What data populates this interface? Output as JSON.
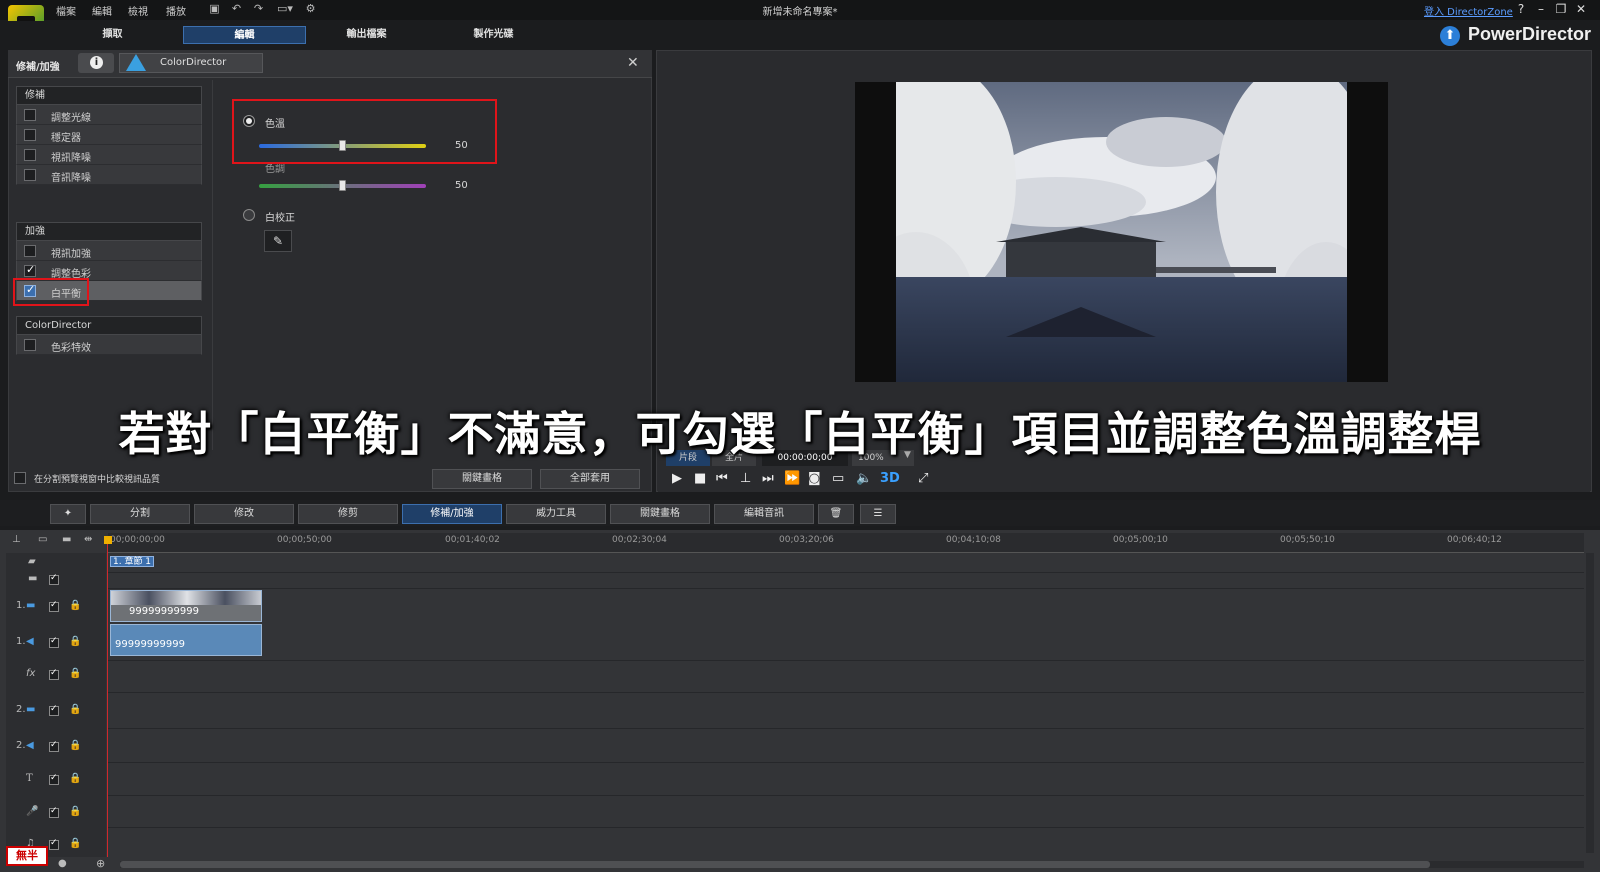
{
  "menubar": {
    "items": [
      "檔案",
      "編輯",
      "檢視",
      "播放"
    ],
    "window_title": "新增未命名專案*",
    "login_link": "登入 DirectorZone",
    "help": "?"
  },
  "main_tabs": [
    "擷取",
    "編輯",
    "輸出檔案",
    "製作光碟"
  ],
  "brand": "PowerDirector",
  "panel": {
    "title": "修補/加強",
    "colordirector_tab": "ColorDirector",
    "sections": [
      {
        "header": "修補",
        "items": [
          {
            "label": "調整光線",
            "checked": false
          },
          {
            "label": "穩定器",
            "checked": false
          },
          {
            "label": "視訊降噪",
            "checked": false
          },
          {
            "label": "音訊降噪",
            "checked": false
          }
        ]
      },
      {
        "header": "加強",
        "items": [
          {
            "label": "視訊加強",
            "checked": false
          },
          {
            "label": "調整色彩",
            "checked": true
          },
          {
            "label": "白平衡",
            "checked": true
          }
        ]
      },
      {
        "header": "ColorDirector",
        "items": [
          {
            "label": "色彩特效",
            "checked": false
          }
        ]
      }
    ],
    "wb": {
      "temp_label": "色溫",
      "temp_value": "50",
      "temp_fraction": 0.5,
      "tint_label": "色調",
      "tint_value": "50",
      "tint_fraction": 0.5,
      "calib_label": "白校正"
    },
    "compare_label": "在分割預覽視窗中比較視訊品質",
    "keyframe_button": "關鍵畫格",
    "apply_all_button": "全部套用"
  },
  "preview": {
    "clip_tab": "片段",
    "movie_tab": "全片",
    "timecode": "00:00:00;00",
    "zoom": "100%",
    "mode_3d": "3D"
  },
  "subtitle": "若對「白平衡」不滿意，可勾選「白平衡」項目並調整色溫調整桿",
  "toolbar": {
    "buttons": [
      "分割",
      "修改",
      "修剪",
      "修補/加強",
      "威力工具",
      "關鍵畫格",
      "編輯音訊"
    ]
  },
  "timeline": {
    "ruler": [
      "00;00;00;00",
      "00;00;50;00",
      "00;01;40;02",
      "00;02;30;04",
      "00;03;20;06",
      "00;04;10;08",
      "00;05;00;10",
      "00;05;50;10",
      "00;06;40;12"
    ],
    "chapter": "1. 章節 1",
    "track_labels": [
      "1.",
      "1.",
      "fx",
      "2.",
      "2.",
      "T",
      "",
      ""
    ],
    "clip_video_name": "99999999999",
    "clip_audio_name": "99999999999"
  },
  "stamp": "無半",
  "colors": {
    "accent": "#3c6fae",
    "highlight_red": "#e0141a",
    "bg": "#1b1c1e"
  }
}
